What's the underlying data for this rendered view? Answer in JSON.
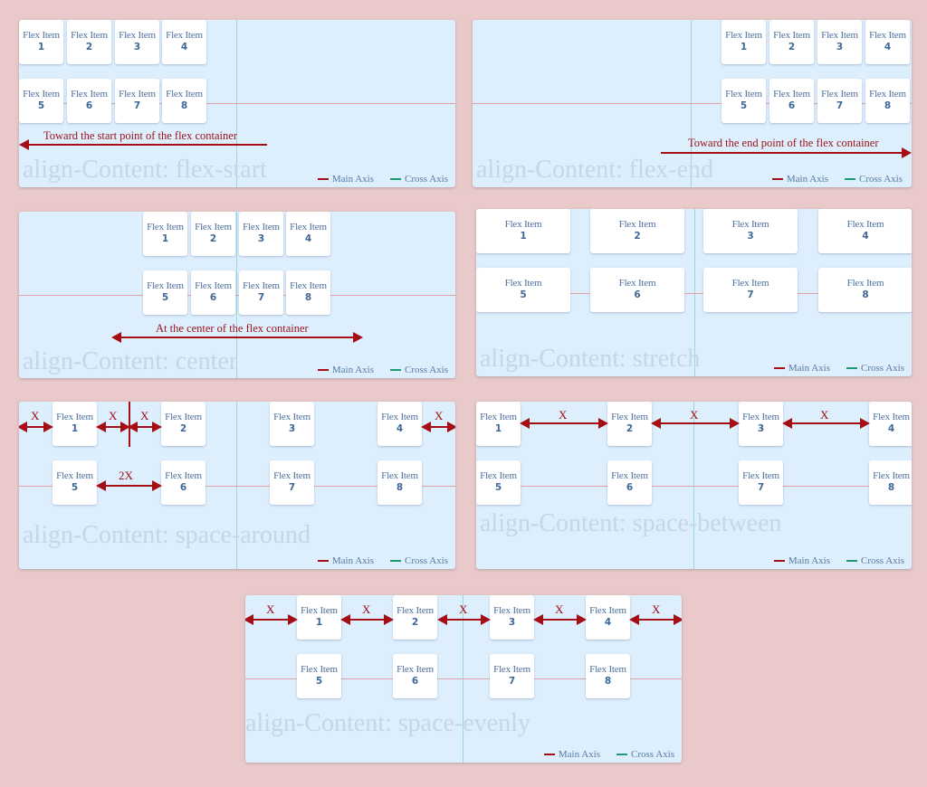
{
  "item_label": "Flex Item",
  "legend": {
    "main": "Main Axis",
    "cross": "Cross Axis",
    "main_color": "#a50e14",
    "cross_color": "#1f9a72"
  },
  "colors": {
    "background": "#e9c9c9",
    "panel": "#ddeefd",
    "arrow": "#a50e14",
    "title": "#c3d6ea",
    "item_text": "#4a6f9c"
  },
  "gap_label": "X",
  "double_gap_label": "2X",
  "items": [
    "1",
    "2",
    "3",
    "4",
    "5",
    "6",
    "7",
    "8"
  ],
  "panels": [
    {
      "id": "flex-start",
      "title": "align-Content: flex-start",
      "caption": "Toward the start point of the flex container"
    },
    {
      "id": "flex-end",
      "title": "align-Content: flex-end",
      "caption": "Toward the end point of the flex container"
    },
    {
      "id": "center",
      "title": "align-Content: center",
      "caption": "At the center of the flex container"
    },
    {
      "id": "stretch",
      "title": "align-Content: stretch",
      "caption": ""
    },
    {
      "id": "space-around",
      "title": "align-Content: space-around",
      "caption": ""
    },
    {
      "id": "space-between",
      "title": "align-Content: space-between",
      "caption": ""
    },
    {
      "id": "space-evenly",
      "title": "align-Content: space-evenly",
      "caption": ""
    }
  ]
}
